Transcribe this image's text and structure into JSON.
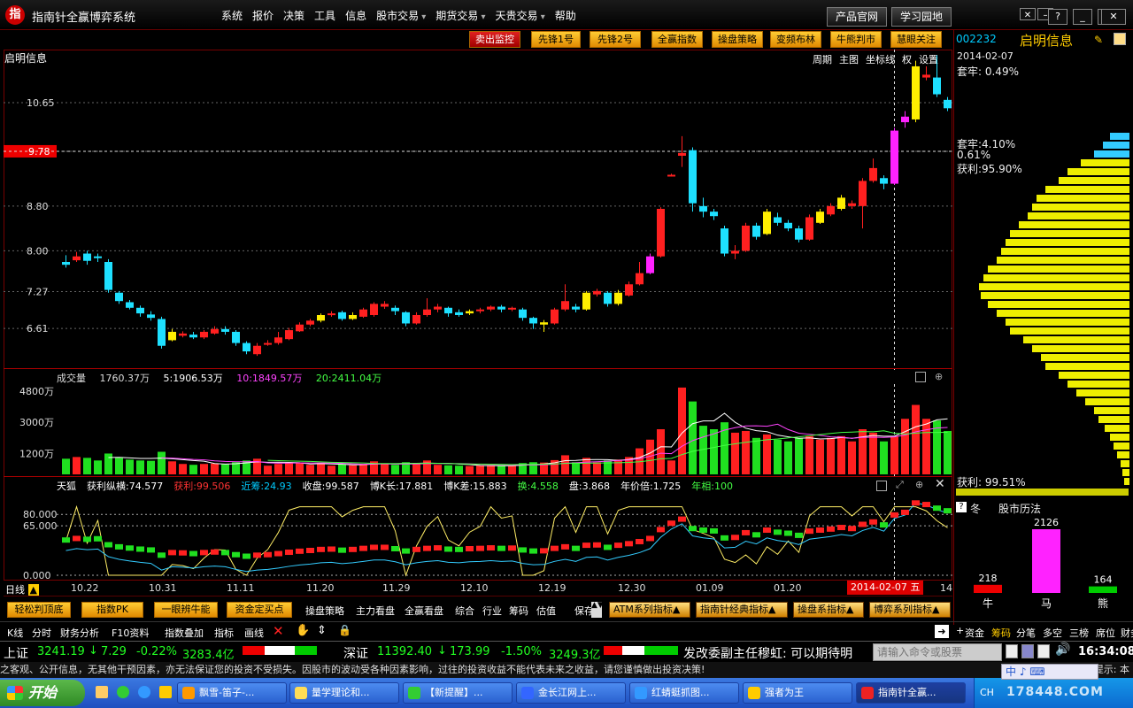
{
  "app": {
    "logo_glyph": "指",
    "title": "指南针全赢博弈系统",
    "menu": [
      {
        "label": "系统",
        "sub": false
      },
      {
        "label": "报价",
        "sub": false
      },
      {
        "label": "决策",
        "sub": false
      },
      {
        "label": "工具",
        "sub": false
      },
      {
        "label": "信息",
        "sub": false
      },
      {
        "label": "股市交易",
        "sub": true
      },
      {
        "label": "期货交易",
        "sub": true
      },
      {
        "label": "天贵交易",
        "sub": true
      },
      {
        "label": "帮助",
        "sub": false
      }
    ],
    "top_buttons": [
      "产品官网",
      "学习园地"
    ]
  },
  "toolbar": [
    "卖出监控",
    "先锋1号",
    "先锋2号",
    "全赢指数",
    "操盘策略",
    "变频布林",
    "牛熊判市",
    "慧眼关注"
  ],
  "stock": {
    "name": "启明信息",
    "code": "002232",
    "chart_menu": [
      "周期",
      "主图",
      "坐标线",
      "权",
      "设置"
    ],
    "price_label": "9.78",
    "volume_header": {
      "label": "成交量",
      "v": "1760.37万",
      "ma5": "5:1906.53万",
      "ma10": "10:1849.57万",
      "ma20": "20:2411.04万"
    },
    "indicator_header": [
      "天狐",
      "获利纵横:74.577",
      "获利:99.506",
      "近筹:24.93",
      "收盘:99.587",
      "博K长:17.881",
      "博K差:15.883",
      "换:4.558",
      "盘:3.868",
      "年价倍:1.725",
      "年相:100"
    ],
    "period": "日线",
    "cursor_date": "2014-02-07 五",
    "x_labels": [
      "10.22",
      "10.31",
      "11.11",
      "11.20",
      "11.29",
      "12.10",
      "12.19",
      "12.30",
      "01.09",
      "01.20"
    ],
    "x_label_last": "14"
  },
  "chart_data": {
    "type": "candlestick",
    "y_ticks": [
      10.65,
      9.78,
      8.8,
      8.0,
      7.27,
      6.61
    ],
    "y_range": [
      5.9,
      11.6
    ],
    "volume_ticks": [
      "4800万",
      "3000万",
      "1200万"
    ],
    "volume_range": [
      0,
      5200
    ],
    "indicator_ticks": [
      "80.000",
      "65.000",
      "0.000"
    ],
    "candles": [
      {
        "o": 7.8,
        "c": 7.75,
        "h": 7.92,
        "l": 7.7,
        "v": 900
      },
      {
        "o": 7.83,
        "c": 7.9,
        "h": 7.98,
        "l": 7.8,
        "v": 1000
      },
      {
        "o": 7.95,
        "c": 7.82,
        "h": 8.0,
        "l": 7.75,
        "v": 950
      },
      {
        "o": 7.9,
        "c": 7.87,
        "h": 7.95,
        "l": 7.8,
        "v": 800
      },
      {
        "o": 7.8,
        "c": 7.3,
        "h": 7.85,
        "l": 7.25,
        "v": 1200
      },
      {
        "o": 7.25,
        "c": 7.1,
        "h": 7.28,
        "l": 7.05,
        "v": 950
      },
      {
        "o": 7.08,
        "c": 6.98,
        "h": 7.12,
        "l": 6.95,
        "v": 850
      },
      {
        "o": 6.98,
        "c": 6.88,
        "h": 7.02,
        "l": 6.82,
        "v": 800
      },
      {
        "o": 6.86,
        "c": 6.8,
        "h": 6.92,
        "l": 6.75,
        "v": 780
      },
      {
        "o": 6.78,
        "c": 6.3,
        "h": 6.82,
        "l": 6.25,
        "v": 1300
      },
      {
        "o": 6.4,
        "c": 6.55,
        "h": 6.6,
        "l": 6.38,
        "v": 750
      },
      {
        "o": 6.48,
        "c": 6.52,
        "h": 6.56,
        "l": 6.45,
        "v": 600
      },
      {
        "o": 6.5,
        "c": 6.45,
        "h": 6.55,
        "l": 6.42,
        "v": 550
      },
      {
        "o": 6.45,
        "c": 6.55,
        "h": 6.58,
        "l": 6.42,
        "v": 600
      },
      {
        "o": 6.52,
        "c": 6.6,
        "h": 6.65,
        "l": 6.5,
        "v": 620
      },
      {
        "o": 6.6,
        "c": 6.55,
        "h": 6.65,
        "l": 6.5,
        "v": 580
      },
      {
        "o": 6.55,
        "c": 6.35,
        "h": 6.58,
        "l": 6.3,
        "v": 700
      },
      {
        "o": 6.35,
        "c": 6.2,
        "h": 6.38,
        "l": 6.15,
        "v": 800
      },
      {
        "o": 6.15,
        "c": 6.3,
        "h": 6.35,
        "l": 6.12,
        "v": 900
      },
      {
        "o": 6.33,
        "c": 6.35,
        "h": 6.4,
        "l": 6.3,
        "v": 500
      },
      {
        "o": 6.35,
        "c": 6.45,
        "h": 6.55,
        "l": 6.32,
        "v": 600
      },
      {
        "o": 6.42,
        "c": 6.58,
        "h": 6.62,
        "l": 6.4,
        "v": 650
      },
      {
        "o": 6.56,
        "c": 6.68,
        "h": 6.72,
        "l": 6.55,
        "v": 680
      },
      {
        "o": 6.68,
        "c": 6.75,
        "h": 6.78,
        "l": 6.65,
        "v": 550
      },
      {
        "o": 6.75,
        "c": 6.85,
        "h": 6.88,
        "l": 6.72,
        "v": 600
      },
      {
        "o": 6.85,
        "c": 6.88,
        "h": 6.92,
        "l": 6.82,
        "v": 500
      },
      {
        "o": 6.9,
        "c": 6.78,
        "h": 6.93,
        "l": 6.75,
        "v": 580
      },
      {
        "o": 6.78,
        "c": 6.85,
        "h": 6.9,
        "l": 6.76,
        "v": 520
      },
      {
        "o": 6.82,
        "c": 6.95,
        "h": 6.98,
        "l": 6.8,
        "v": 600
      },
      {
        "o": 6.85,
        "c": 7.05,
        "h": 7.08,
        "l": 6.82,
        "v": 750
      },
      {
        "o": 7.0,
        "c": 7.05,
        "h": 7.1,
        "l": 6.96,
        "v": 600
      },
      {
        "o": 6.98,
        "c": 6.92,
        "h": 7.02,
        "l": 6.85,
        "v": 550
      },
      {
        "o": 6.9,
        "c": 6.7,
        "h": 6.92,
        "l": 6.65,
        "v": 700
      },
      {
        "o": 6.7,
        "c": 6.85,
        "h": 6.9,
        "l": 6.68,
        "v": 600
      },
      {
        "o": 6.85,
        "c": 6.95,
        "h": 7.15,
        "l": 6.82,
        "v": 800
      },
      {
        "o": 6.95,
        "c": 7.0,
        "h": 7.05,
        "l": 6.9,
        "v": 550
      },
      {
        "o": 6.98,
        "c": 6.88,
        "h": 7.0,
        "l": 6.82,
        "v": 520
      },
      {
        "o": 6.9,
        "c": 6.85,
        "h": 6.95,
        "l": 6.82,
        "v": 500
      },
      {
        "o": 6.88,
        "c": 6.92,
        "h": 6.95,
        "l": 6.85,
        "v": 480
      },
      {
        "o": 6.92,
        "c": 6.95,
        "h": 6.98,
        "l": 6.88,
        "v": 500
      },
      {
        "o": 6.95,
        "c": 7.0,
        "h": 7.02,
        "l": 6.92,
        "v": 520
      },
      {
        "o": 7.0,
        "c": 6.95,
        "h": 7.03,
        "l": 6.9,
        "v": 500
      },
      {
        "o": 6.95,
        "c": 6.98,
        "h": 7.0,
        "l": 6.92,
        "v": 480
      },
      {
        "o": 6.95,
        "c": 6.8,
        "h": 6.98,
        "l": 6.75,
        "v": 650
      },
      {
        "o": 6.8,
        "c": 6.7,
        "h": 6.82,
        "l": 6.6,
        "v": 700
      },
      {
        "o": 6.68,
        "c": 6.72,
        "h": 6.76,
        "l": 6.55,
        "v": 680
      },
      {
        "o": 6.7,
        "c": 6.95,
        "h": 6.98,
        "l": 6.68,
        "v": 820
      },
      {
        "o": 6.95,
        "c": 7.1,
        "h": 7.4,
        "l": 6.92,
        "v": 1100
      },
      {
        "o": 7.0,
        "c": 6.95,
        "h": 7.05,
        "l": 6.9,
        "v": 700
      },
      {
        "o": 6.95,
        "c": 7.25,
        "h": 7.28,
        "l": 6.93,
        "v": 950
      },
      {
        "o": 7.22,
        "c": 7.28,
        "h": 7.32,
        "l": 7.18,
        "v": 700
      },
      {
        "o": 7.25,
        "c": 7.05,
        "h": 7.28,
        "l": 7.0,
        "v": 800
      },
      {
        "o": 7.05,
        "c": 7.25,
        "h": 7.3,
        "l": 7.02,
        "v": 850
      },
      {
        "o": 7.2,
        "c": 7.4,
        "h": 7.45,
        "l": 7.18,
        "v": 1000
      },
      {
        "o": 7.4,
        "c": 7.6,
        "h": 7.8,
        "l": 7.38,
        "v": 1500
      },
      {
        "o": 7.6,
        "c": 7.9,
        "h": 7.95,
        "l": 7.58,
        "v": 2000
      },
      {
        "o": 7.9,
        "c": 8.75,
        "h": 8.78,
        "l": 7.88,
        "v": 2600
      },
      {
        "o": 9.35,
        "c": 9.36,
        "h": 9.38,
        "l": 9.33,
        "v": 800
      },
      {
        "o": 9.7,
        "c": 9.75,
        "h": 10.05,
        "l": 9.5,
        "v": 5000
      },
      {
        "o": 9.8,
        "c": 8.85,
        "h": 9.85,
        "l": 8.7,
        "v": 4200
      },
      {
        "o": 8.8,
        "c": 8.7,
        "h": 8.95,
        "l": 8.6,
        "v": 2800
      },
      {
        "o": 8.7,
        "c": 8.62,
        "h": 8.75,
        "l": 8.55,
        "v": 2600
      },
      {
        "o": 8.4,
        "c": 7.95,
        "h": 8.45,
        "l": 7.9,
        "v": 3000
      },
      {
        "o": 7.95,
        "c": 8.0,
        "h": 8.1,
        "l": 7.85,
        "v": 2400
      },
      {
        "o": 8.0,
        "c": 8.45,
        "h": 8.5,
        "l": 7.98,
        "v": 2500
      },
      {
        "o": 8.45,
        "c": 8.25,
        "h": 8.5,
        "l": 8.2,
        "v": 2100
      },
      {
        "o": 8.3,
        "c": 8.7,
        "h": 8.75,
        "l": 8.28,
        "v": 2300
      },
      {
        "o": 8.6,
        "c": 8.5,
        "h": 8.68,
        "l": 8.45,
        "v": 2000
      },
      {
        "o": 8.5,
        "c": 8.4,
        "h": 8.55,
        "l": 8.35,
        "v": 1900
      },
      {
        "o": 8.4,
        "c": 8.2,
        "h": 8.45,
        "l": 8.15,
        "v": 2100
      },
      {
        "o": 8.2,
        "c": 8.6,
        "h": 8.65,
        "l": 8.18,
        "v": 2200
      },
      {
        "o": 8.5,
        "c": 8.7,
        "h": 8.75,
        "l": 8.48,
        "v": 2000
      },
      {
        "o": 8.65,
        "c": 8.8,
        "h": 8.85,
        "l": 8.62,
        "v": 2100
      },
      {
        "o": 8.75,
        "c": 8.95,
        "h": 9.0,
        "l": 8.72,
        "v": 2200
      },
      {
        "o": 8.8,
        "c": 8.85,
        "h": 8.9,
        "l": 8.75,
        "v": 1900
      },
      {
        "o": 8.8,
        "c": 9.25,
        "h": 9.3,
        "l": 8.4,
        "v": 2600
      },
      {
        "o": 9.25,
        "c": 9.48,
        "h": 9.65,
        "l": 9.22,
        "v": 2400
      },
      {
        "o": 9.3,
        "c": 9.2,
        "h": 9.35,
        "l": 9.1,
        "v": 1900
      },
      {
        "o": 9.2,
        "c": 10.15,
        "h": 10.2,
        "l": 9.18,
        "v": 2200
      },
      {
        "o": 10.3,
        "c": 10.4,
        "h": 10.5,
        "l": 10.2,
        "v": 3200
      },
      {
        "o": 10.35,
        "c": 11.3,
        "h": 11.4,
        "l": 10.3,
        "v": 4000
      },
      {
        "o": 11.1,
        "c": 11.15,
        "h": 11.3,
        "l": 11.05,
        "v": 3200
      },
      {
        "o": 11.1,
        "c": 10.8,
        "h": 11.5,
        "l": 10.75,
        "v": 3100
      },
      {
        "o": 10.7,
        "c": 10.55,
        "h": 10.75,
        "l": 10.5,
        "v": 2500
      }
    ],
    "magenta_candles": [
      55,
      78,
      79
    ]
  },
  "right": {
    "date": "2014-02-07",
    "line1": "套牢: 0.49%",
    "line2": "套牢:4.10%",
    "line3": "0.61%",
    "line4": "获利:95.90%",
    "profit": "获利: 99.51%",
    "tabs": [
      "冬",
      "股市历法"
    ],
    "bull": {
      "label": "牛",
      "value": "218"
    },
    "horse": {
      "label": "马",
      "value": "2126"
    },
    "bear": {
      "label": "熊",
      "value": "164"
    },
    "chip_profile": [
      22,
      30,
      40,
      55,
      70,
      80,
      95,
      105,
      110,
      115,
      125,
      135,
      140,
      145,
      150,
      160,
      165,
      170,
      168,
      160,
      150,
      140,
      135,
      120,
      110,
      100,
      95,
      80,
      70,
      60,
      50,
      40,
      35,
      28,
      22,
      18,
      14,
      10,
      8,
      6
    ]
  },
  "bottom": {
    "yellow_buttons": [
      "轻松判顶底",
      "指数PK",
      "一眼辨牛能",
      "资金定买点"
    ],
    "links": [
      "操盘策略",
      "主力看盘",
      "全赢看盘",
      "综合",
      "行业",
      "筹码",
      "估值",
      "保存"
    ],
    "series_buttons": [
      "ATM系列指标",
      "指南针经典指标",
      "操盘系指标",
      "博弈系列指标"
    ],
    "tools_left": [
      "K线",
      "分时",
      "财务分析",
      "F10资料"
    ],
    "tools_mid": [
      "指数叠加",
      "指标",
      "画线"
    ],
    "tools_right": [
      "资金",
      "筹码",
      "分笔",
      "多空",
      "三榜",
      "席位",
      "财务"
    ]
  },
  "status": {
    "sh_label": "上证",
    "sh_value": "3241.19",
    "sh_change": "7.29",
    "sh_pct": "-0.22%",
    "sh_amount": "3283.4亿",
    "sz_label": "深证",
    "sz_value": "11392.40",
    "sz_change": "173.99",
    "sz_pct": "-1.50%",
    "sz_amount": "3249.3亿",
    "news": "发改委副主任穆虹: 可以期待明",
    "cmd_placeholder": "请输入命令或股票",
    "clock": "16:34:08",
    "ticker": "之客观、公开信息，无其他干预因素，亦无法保证您的投资不受损失。因股市的波动受各种因素影响，过往的投资收益不能代表未来之收益，请您谨慎做出投资决策!",
    "ticker_right": "指南针公司郑重提示: 本"
  },
  "taskbar": {
    "start": "开始",
    "tasks": [
      "飘雪-笛子-...",
      "量学理论和...",
      "【新提醒】...",
      "金长江网上...",
      "红蜻蜓抓图...",
      "强者为王",
      "指南针全赢..."
    ],
    "tray_ime": "CH",
    "watermark": "178448.COM"
  },
  "colors": {
    "up": "#ff2020",
    "down": "#1ee0ff",
    "magenta": "#ff22ff",
    "yellow": "#ffee00",
    "green": "#20e020"
  }
}
